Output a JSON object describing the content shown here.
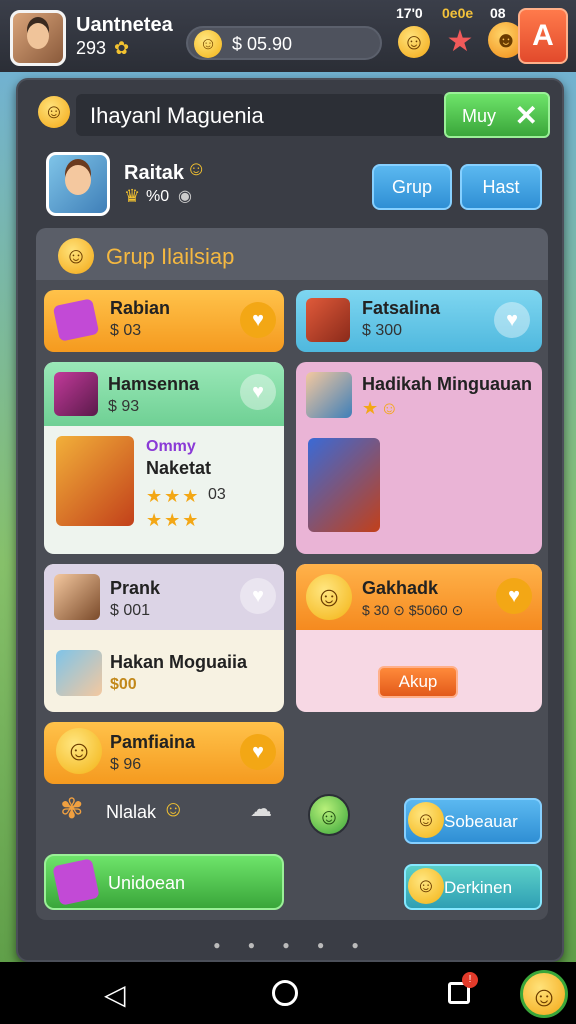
{
  "header": {
    "user_name": "Uantnetea",
    "user_level": "293",
    "coins": "$ 05.90",
    "counter_a": "17'0",
    "counter_b": "0e0e",
    "counter_c": "08",
    "a_button": "A"
  },
  "dialog": {
    "title": "Ihayanl Maguenia",
    "close_label": "Muy",
    "close_icon": "✕"
  },
  "profile": {
    "name": "Raitak",
    "stat": "%0",
    "grup_label": "Grup",
    "hast_label": "Hast"
  },
  "section": {
    "title": "Grup Ilailsiap"
  },
  "cards": {
    "c1": {
      "name": "Rabian",
      "sub": "$ 03"
    },
    "c2": {
      "name": "Fatsalina",
      "sub": "$ 300"
    },
    "c3": {
      "name": "Hamsenna",
      "sub": "$ 93",
      "inner_tag": "Ommy",
      "inner_name": "Naketat",
      "inner_stars_value": "03"
    },
    "c4": {
      "name": "Hadikah Minguauan"
    },
    "c5": {
      "name": "Prank",
      "sub": "$ 001",
      "inner_name": "Hakan Moguaiia",
      "inner_sub": "$00"
    },
    "c6": {
      "name": "Gakhadk",
      "sub": "$ 30 ⊙ $5060 ⊙",
      "action_label": "Akup"
    },
    "c7": {
      "name": "Pamfiaina",
      "sub": "$ 96"
    }
  },
  "misc": {
    "label": "Nlalak"
  },
  "buttons": {
    "green_label": "Unidoean",
    "sob_label": "Sobeauar",
    "derk_label": "Derkinen"
  },
  "colors": {
    "accent_green": "#3aa63a",
    "accent_blue": "#2f8fd4",
    "panel": "#3a3d45",
    "section_title": "#f5b840"
  }
}
